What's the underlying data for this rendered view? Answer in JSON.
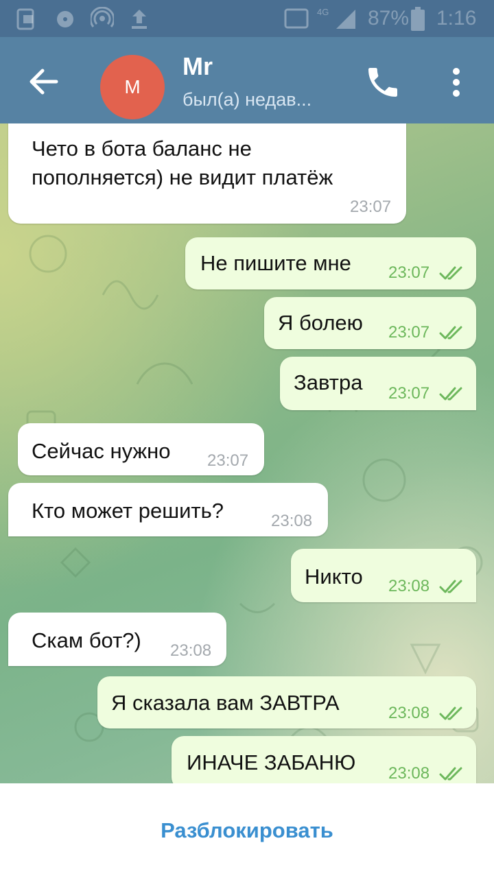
{
  "status_bar": {
    "network_label": "4G",
    "battery_percent": "87%",
    "time": "1:16"
  },
  "header": {
    "avatar_letter": "M",
    "contact_name": "Mr",
    "contact_status": "был(а) недав...",
    "colors": {
      "header": "#5682a3",
      "avatar": "#e2624e"
    }
  },
  "messages": [
    {
      "direction": "in",
      "lines": [
        "Чето в бота баланс не",
        "пополняется) не видит платёж"
      ],
      "time": "23:07"
    },
    {
      "direction": "out",
      "text": "Не пишите мне",
      "time": "23:07",
      "read": true
    },
    {
      "direction": "out",
      "text": "Я болею",
      "time": "23:07",
      "read": true
    },
    {
      "direction": "out",
      "text": "Завтра",
      "time": "23:07",
      "read": true
    },
    {
      "direction": "in",
      "text": "Сейчас нужно",
      "time": "23:07"
    },
    {
      "direction": "in",
      "text": "Кто может решить?",
      "time": "23:08"
    },
    {
      "direction": "out",
      "text": "Никто",
      "time": "23:08",
      "read": true
    },
    {
      "direction": "in",
      "text": "Скам бот?)",
      "time": "23:08"
    },
    {
      "direction": "out",
      "text": "Я сказала вам ЗАВТРА",
      "time": "23:08",
      "read": true
    },
    {
      "direction": "out",
      "text": "ИНАЧЕ ЗАБАНЮ",
      "time": "23:08",
      "read": true
    }
  ],
  "bottom": {
    "unblock_label": "Разблокировать"
  }
}
